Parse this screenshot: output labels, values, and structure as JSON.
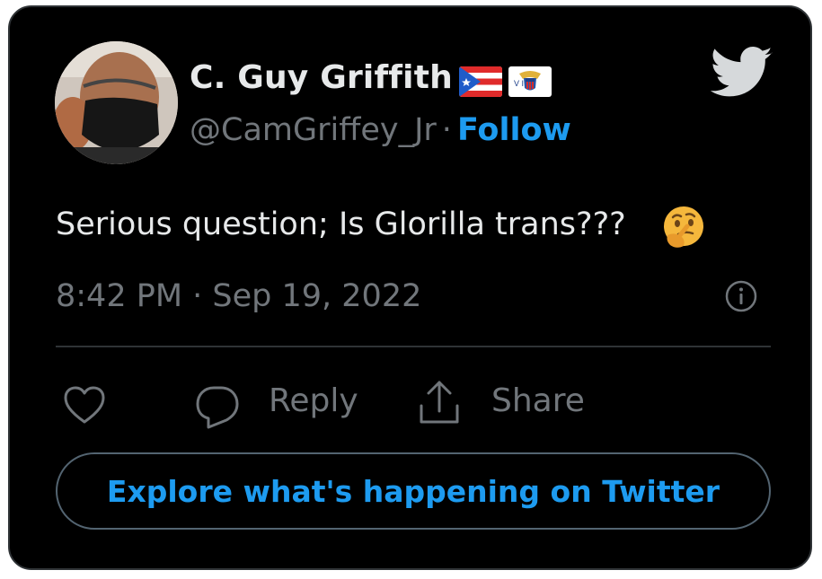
{
  "author": {
    "name": "C. Guy Griffith",
    "handle": "@CamGriffey_Jr",
    "separator": "·",
    "follow_label": "Follow",
    "flags": [
      "puerto-rico-flag",
      "us-virgin-islands-flag"
    ],
    "flag_vi_text": "V I"
  },
  "tweet": {
    "text": "Serious question; Is Glorilla trans???",
    "emoji": "thinking-face-emoji",
    "timestamp": "8:42 PM · Sep 19, 2022"
  },
  "actions": {
    "reply_label": "Reply",
    "share_label": "Share"
  },
  "explore": {
    "label": "Explore what's happening on Twitter"
  },
  "colors": {
    "background": "#000000",
    "text_primary": "#e7e9ea",
    "text_secondary": "#71767b",
    "accent": "#1d9bf0",
    "border": "#2f3336"
  },
  "icons": [
    "twitter-bird-icon",
    "info-icon",
    "heart-icon",
    "reply-icon",
    "share-icon"
  ]
}
